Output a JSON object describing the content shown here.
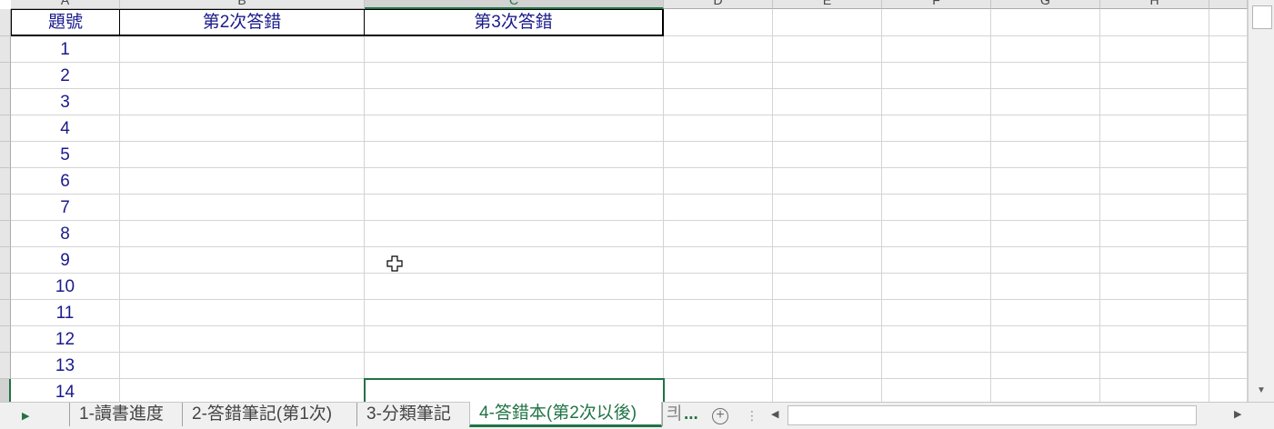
{
  "columns": [
    "A",
    "B",
    "C",
    "D",
    "E",
    "F",
    "G",
    "H"
  ],
  "header_row": {
    "a": "題號",
    "b": "第2次答錯",
    "c": "第3次答錯"
  },
  "rows": [
    "1",
    "2",
    "3",
    "4",
    "5",
    "6",
    "7",
    "8",
    "9",
    "10",
    "11",
    "12",
    "13",
    "14"
  ],
  "sheet_tabs": [
    {
      "label": "1-讀書進度",
      "active": false
    },
    {
      "label": "2-答錯筆記(第1次)",
      "active": false
    },
    {
      "label": "3-分類筆記",
      "active": false
    },
    {
      "label": "4-答錯本(第2次以後)",
      "active": true
    }
  ],
  "tab_overflow_glyph": "킈",
  "more_tabs": "...",
  "add_sheet": "+",
  "icons": {
    "cursor": "plus-cursor-icon",
    "nav_next": "triangle-right-icon",
    "scroll_left": "triangle-left-icon",
    "scroll_right": "triangle-right-icon",
    "scroll_down": "triangle-down-icon"
  },
  "colors": {
    "accent": "#217346",
    "cell_text": "#1a1a8c"
  }
}
